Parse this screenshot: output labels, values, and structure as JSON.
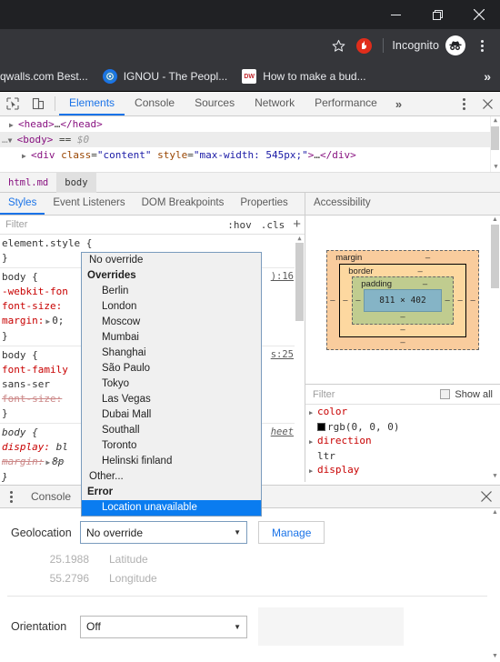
{
  "browser": {
    "window_controls": [
      "minimize",
      "maximize",
      "close"
    ],
    "toolbar": {
      "bookmark_star": "star-icon",
      "extension": "extension-icon",
      "incognito_label": "Incognito",
      "menu": "kebab-menu-icon"
    },
    "bookmarks": [
      {
        "title": "qwalls.com Best...",
        "favicon": "none"
      },
      {
        "title": "IGNOU - The Peopl...",
        "favicon": "ignou"
      },
      {
        "title": "How to make a bud...",
        "favicon": "dw"
      }
    ],
    "bookmarks_overflow": "»"
  },
  "devtools": {
    "toolbar": {
      "inspect_icon": "inspect-element-icon",
      "device_icon": "device-toolbar-icon",
      "tabs": [
        "Elements",
        "Console",
        "Sources",
        "Network",
        "Performance"
      ],
      "active_tab": "Elements",
      "more_tabs": "»",
      "settings": "kebab-menu-icon",
      "close": "close-icon"
    },
    "dom_tree": {
      "rows": [
        {
          "indent": 1,
          "triangle": "▶",
          "text": "<head>…</head>"
        },
        {
          "indent": 0,
          "triangle": "▼",
          "text": "<body> == $0",
          "selected": true,
          "prefix": "…"
        },
        {
          "indent": 2,
          "triangle": "▶",
          "tag_open": "<div",
          "attr1": "class",
          "val1": "\"content\"",
          "attr2": "style",
          "val2": "\"max-width: 545px;\"",
          "tail": ">…</div>"
        }
      ]
    },
    "breadcrumb": [
      "html.md",
      "body"
    ],
    "breadcrumb_active": "body",
    "sidebar_tabs": [
      "Styles",
      "Event Listeners",
      "DOM Breakpoints",
      "Properties",
      "Accessibility"
    ],
    "sidebar_active": "Styles",
    "styles": {
      "filter_placeholder": "Filter",
      "hov_button": ":hov",
      "cls_button": ".cls",
      "new_rule_button": "+",
      "rules": [
        {
          "selector": "element.style {",
          "close": "}",
          "source": "",
          "declarations": []
        },
        {
          "selector": "body {",
          "close": "}",
          "source": "):16",
          "declarations": [
            {
              "prop": "-webkit-fon",
              "value": "",
              "truncated": true
            },
            {
              "prop": "font-size:",
              "value": "",
              "truncated": true
            },
            {
              "prop": "margin:",
              "value": "0;",
              "expandable": true
            }
          ]
        },
        {
          "selector": "body {",
          "close": "}",
          "source": "s:25",
          "declarations": [
            {
              "prop": "font-family",
              "value": "",
              "truncated": true
            },
            {
              "prop": "",
              "value": "sans-ser",
              "truncated": true,
              "cont": true
            },
            {
              "prop": "font-size:",
              "value": "",
              "struck": true
            }
          ]
        },
        {
          "selector": "body {",
          "close": "}",
          "source": "heet",
          "ua": true,
          "declarations": [
            {
              "prop": "display:",
              "value": "bl",
              "truncated": true
            },
            {
              "prop": "margin:",
              "value": "8p",
              "struck": true,
              "expandable": true
            }
          ]
        }
      ]
    },
    "box_model": {
      "margin_label": "margin",
      "border_label": "border",
      "padding_label": "padding",
      "content_size": "811 × 402",
      "dash": "–"
    },
    "computed": {
      "filter_placeholder": "Filter",
      "show_all_label": "Show all",
      "show_all_checked": false,
      "properties": [
        {
          "name": "color",
          "value": "rgb(0, 0, 0)",
          "swatch": "#000000"
        },
        {
          "name": "direction",
          "value": "ltr"
        },
        {
          "name": "display",
          "value": ""
        }
      ]
    },
    "drawer": {
      "menu_icon": "kebab-menu-icon",
      "tab": "Console",
      "close": "close-icon"
    },
    "sensors": {
      "geolocation_label": "Geolocation",
      "geolocation_value": "No override",
      "manage_button": "Manage",
      "latitude_value": "25.1988",
      "latitude_label": "Latitude",
      "longitude_value": "55.2796",
      "longitude_label": "Longitude",
      "orientation_label": "Orientation",
      "orientation_value": "Off"
    },
    "geolocation_dropdown": {
      "open": true,
      "items": [
        {
          "label": "No override",
          "type": "item"
        },
        {
          "label": "Overrides",
          "type": "group"
        },
        {
          "label": "Berlin",
          "type": "child"
        },
        {
          "label": "London",
          "type": "child"
        },
        {
          "label": "Moscow",
          "type": "child"
        },
        {
          "label": "Mumbai",
          "type": "child"
        },
        {
          "label": "Shanghai",
          "type": "child"
        },
        {
          "label": "São Paulo",
          "type": "child"
        },
        {
          "label": "Tokyo",
          "type": "child"
        },
        {
          "label": "Las Vegas",
          "type": "child"
        },
        {
          "label": "Dubai Mall",
          "type": "child"
        },
        {
          "label": "Southall",
          "type": "child"
        },
        {
          "label": "Toronto",
          "type": "child"
        },
        {
          "label": "Helinski finland",
          "type": "child"
        },
        {
          "label": "Other...",
          "type": "item"
        },
        {
          "label": "Error",
          "type": "group"
        },
        {
          "label": "Location unavailable",
          "type": "child",
          "selected": true
        }
      ],
      "highlight_color": "#0a7cf0"
    }
  },
  "colors": {
    "chrome_titlebar": "#202124",
    "chrome_toolbar": "#35363a",
    "devtools_bg": "#ffffff",
    "accent_blue": "#1a73e8",
    "margin_box": "#f9cc9d",
    "border_box": "#fdd8a0",
    "padding_box": "#c0cc8f",
    "content_box": "#85b4c6"
  }
}
